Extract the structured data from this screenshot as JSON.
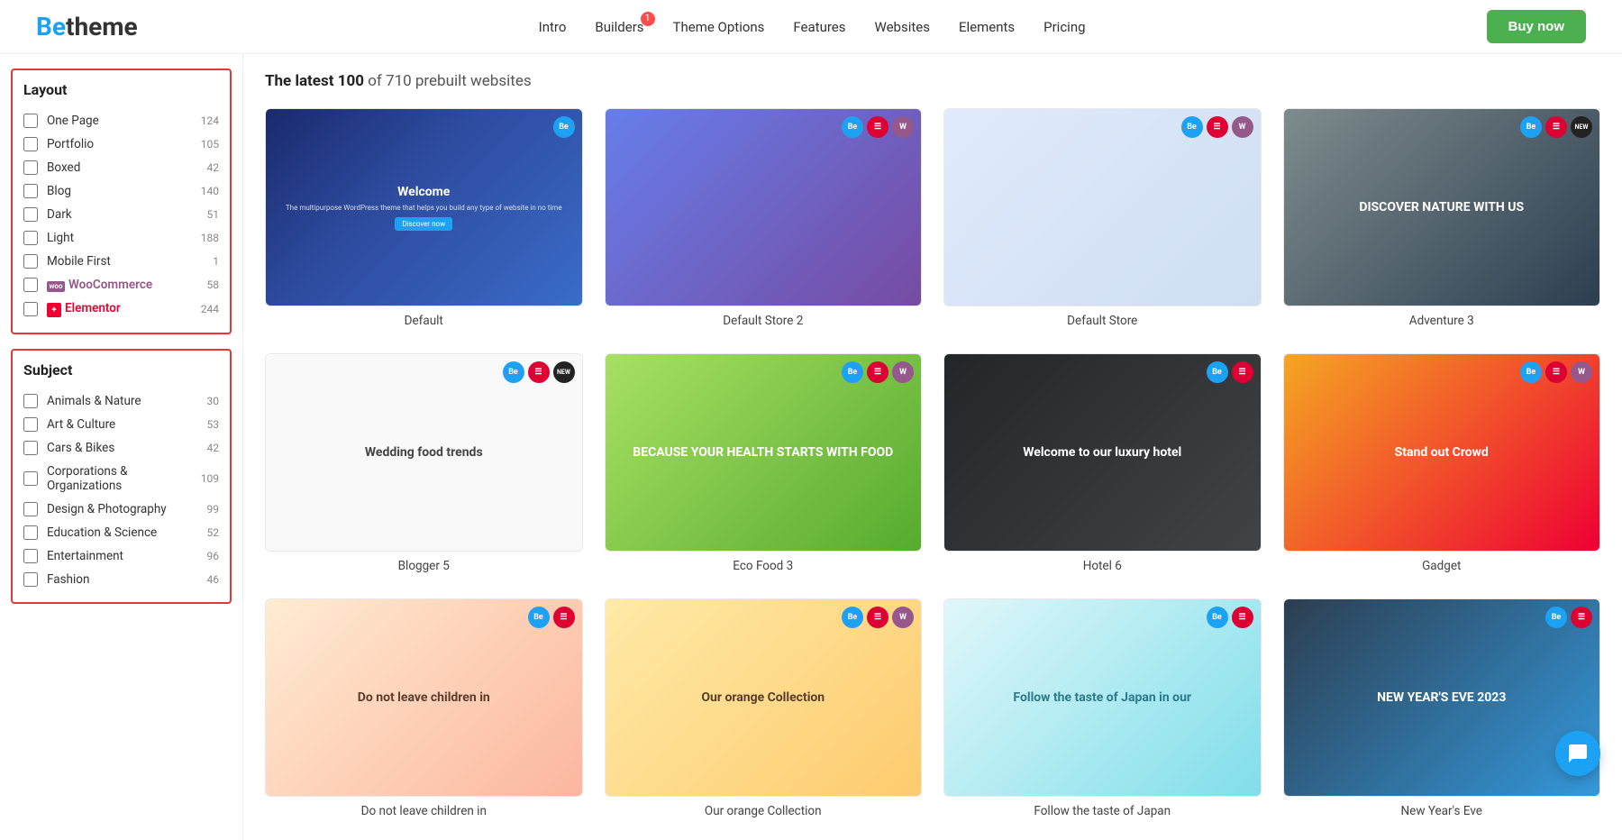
{
  "header": {
    "logo_be": "Be",
    "logo_theme": "theme",
    "nav_items": [
      {
        "id": "intro",
        "label": "Intro",
        "badge": null
      },
      {
        "id": "builders",
        "label": "Builders",
        "badge": "1"
      },
      {
        "id": "theme-options",
        "label": "Theme Options",
        "badge": null
      },
      {
        "id": "features",
        "label": "Features",
        "badge": null
      },
      {
        "id": "websites",
        "label": "Websites",
        "badge": null
      },
      {
        "id": "elements",
        "label": "Elements",
        "badge": null
      },
      {
        "id": "pricing",
        "label": "Pricing",
        "badge": null
      }
    ],
    "buy_button": "Buy now"
  },
  "sidebar": {
    "layout_title": "Layout",
    "layout_items": [
      {
        "id": "one-page",
        "label": "One Page",
        "count": 124
      },
      {
        "id": "portfolio",
        "label": "Portfolio",
        "count": 105
      },
      {
        "id": "boxed",
        "label": "Boxed",
        "count": 42
      },
      {
        "id": "blog",
        "label": "Blog",
        "count": 140
      },
      {
        "id": "dark",
        "label": "Dark",
        "count": 51
      },
      {
        "id": "light",
        "label": "Light",
        "count": 188
      },
      {
        "id": "mobile-first",
        "label": "Mobile First",
        "count": 1
      },
      {
        "id": "woocommerce",
        "label": "WooCommerce",
        "count": 58,
        "type": "woo"
      },
      {
        "id": "elementor",
        "label": "Elementor",
        "count": 244,
        "type": "elementor"
      }
    ],
    "subject_title": "Subject",
    "subject_items": [
      {
        "id": "animals-nature",
        "label": "Animals & Nature",
        "count": 30
      },
      {
        "id": "art-culture",
        "label": "Art & Culture",
        "count": 53
      },
      {
        "id": "cars-bikes",
        "label": "Cars & Bikes",
        "count": 42
      },
      {
        "id": "corporations-organizations",
        "label": "Corporations & Organizations",
        "count": 109
      },
      {
        "id": "design-photography",
        "label": "Design & Photography",
        "count": 99
      },
      {
        "id": "education-science",
        "label": "Education & Science",
        "count": 52
      },
      {
        "id": "entertainment",
        "label": "Entertainment",
        "count": 96
      },
      {
        "id": "fashion",
        "label": "Fashion",
        "count": 46
      }
    ]
  },
  "content": {
    "header_latest": "The latest 100",
    "header_total": "of 710 prebuilt websites",
    "cards": [
      {
        "id": "default",
        "label": "Default",
        "badges": [
          "be"
        ],
        "thumb_type": "default",
        "thumb_text": "Welcome",
        "thumb_sub": "The multipurpose WordPress theme that helps you build any type of website in no time"
      },
      {
        "id": "default-store-2",
        "label": "Default Store 2",
        "badges": [
          "be",
          "el",
          "woo"
        ],
        "thumb_type": "default2"
      },
      {
        "id": "default-store",
        "label": "Default Store",
        "badges": [
          "be",
          "el",
          "woo"
        ],
        "thumb_type": "default-store"
      },
      {
        "id": "adventure-3",
        "label": "Adventure 3",
        "badges": [
          "be",
          "el",
          "new"
        ],
        "thumb_type": "adventure",
        "thumb_text": "DISCOVER NATURE WITH US"
      },
      {
        "id": "blogger-5",
        "label": "Blogger 5",
        "badges": [
          "be",
          "el",
          "new"
        ],
        "thumb_type": "blogger",
        "thumb_text": "Wedding food trends"
      },
      {
        "id": "eco-food-3",
        "label": "Eco Food 3",
        "badges": [
          "be",
          "el",
          "woo"
        ],
        "thumb_type": "ecofood",
        "thumb_text": "BECAUSE YOUR HEALTH STARTS WITH FOOD"
      },
      {
        "id": "hotel-6",
        "label": "Hotel 6",
        "badges": [
          "be",
          "el"
        ],
        "thumb_type": "hotel",
        "thumb_text": "Welcome to our luxury hotel"
      },
      {
        "id": "gadget",
        "label": "Gadget",
        "badges": [
          "be",
          "el",
          "woo"
        ],
        "thumb_type": "gadget",
        "thumb_text": "Stand out Crowd"
      },
      {
        "id": "donot-leave",
        "label": "Do not leave children in",
        "badges": [
          "be",
          "el"
        ],
        "thumb_type": "donot",
        "thumb_text": "Do not leave children in"
      },
      {
        "id": "orange-collection",
        "label": "Our orange Collection",
        "badges": [
          "be",
          "el",
          "woo"
        ],
        "thumb_type": "orange",
        "thumb_text": "Our orange Collection"
      },
      {
        "id": "japanese-food",
        "label": "Follow the taste of Japan",
        "badges": [
          "be",
          "el"
        ],
        "thumb_type": "japanese",
        "thumb_text": "Follow the taste of Japan in our"
      },
      {
        "id": "new-year",
        "label": "New Year's Eve",
        "badges": [
          "be",
          "el"
        ],
        "thumb_type": "newyear",
        "thumb_text": "NEW YEAR'S EVE 2023"
      }
    ]
  }
}
